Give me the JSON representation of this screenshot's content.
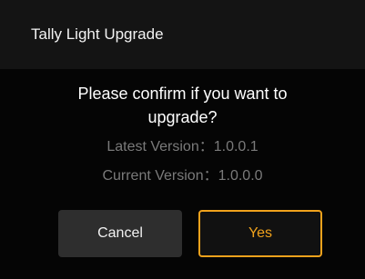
{
  "dialog": {
    "title": "Tally Light Upgrade",
    "message": "Please confirm if you want to upgrade?",
    "latest_version_label": "Latest Version：",
    "latest_version_value": "1.0.0.1",
    "current_version_label": "Current Version：",
    "current_version_value": "1.0.0.0",
    "cancel_label": "Cancel",
    "yes_label": "Yes"
  },
  "colors": {
    "background": "#000000",
    "title_bar": "#141414",
    "accent": "#f0a21c",
    "cancel_button": "#2e2e2e",
    "muted_text": "#7a7a7a"
  }
}
